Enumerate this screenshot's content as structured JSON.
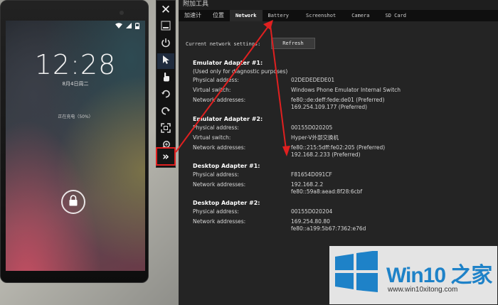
{
  "phone": {
    "status_icons": [
      "wifi-icon",
      "signal-icon",
      "battery-icon"
    ],
    "clock": "12:28",
    "date": "8月4日周二",
    "charging": "正在充电（50%）"
  },
  "toolbar": {
    "buttons": [
      "close-icon",
      "minimize-icon",
      "power-icon",
      "pointer-icon",
      "touch-icon",
      "rotate-left-icon",
      "rotate-right-icon",
      "fit-screen-icon",
      "zoom-icon",
      "double-chevron-right-icon"
    ]
  },
  "window": {
    "title": "附加工具",
    "tabs": [
      {
        "label": "加速计"
      },
      {
        "label": "位置"
      },
      {
        "label": "Network"
      },
      {
        "label": "Battery"
      },
      {
        "label": "Screenshot"
      },
      {
        "label": "Camera"
      },
      {
        "label": "SD Card"
      }
    ],
    "active_tab": "Network"
  },
  "network": {
    "current_settings_label": "Current network settings:",
    "refresh_label": "Refresh",
    "adapters": [
      {
        "title": "Emulator Adapter #1:",
        "note": "(Used only for diagnostic purposes)",
        "rows": [
          {
            "key": "Physical address:",
            "value": "02DEDEDEDE01"
          },
          {
            "key": "Virtual switch:",
            "value": "Windows Phone Emulator Internal Switch"
          },
          {
            "key": "Network addresses:",
            "value": "fe80::de:deff:fede:de01 (Preferred)",
            "value2": "169.254.109.177 (Preferred)"
          }
        ]
      },
      {
        "title": "Emulator Adapter #2:",
        "rows": [
          {
            "key": "Physical address:",
            "value": "00155D020205"
          },
          {
            "key": "Virtual switch:",
            "value": "Hyper-V外部交换机"
          },
          {
            "key": "Network addresses:",
            "value": "fe80::215:5dff:fe02:205 (Preferred)",
            "value2": "192.168.2.233 (Preferred)"
          }
        ]
      },
      {
        "title": "Desktop Adapter #1:",
        "rows": [
          {
            "key": "Physical address:",
            "value": "F81654D091CF"
          },
          {
            "key": "Network addresses:",
            "value": "192.168.2.2",
            "value2": "fe80::59a8:aead:8f28:6cbf"
          }
        ]
      },
      {
        "title": "Desktop Adapter #2:",
        "rows": [
          {
            "key": "Physical address:",
            "value": "00155D020204"
          },
          {
            "key": "Network addresses:",
            "value": "169.254.80.80",
            "value2": "fe80::a199:5b67:7362:e76d"
          }
        ]
      }
    ]
  },
  "watermark": {
    "brand": "Win10 之家",
    "url": "www.win10xitong.com"
  },
  "colors": {
    "annotation_red": "#e02020",
    "brand_blue": "#1e82c8"
  }
}
